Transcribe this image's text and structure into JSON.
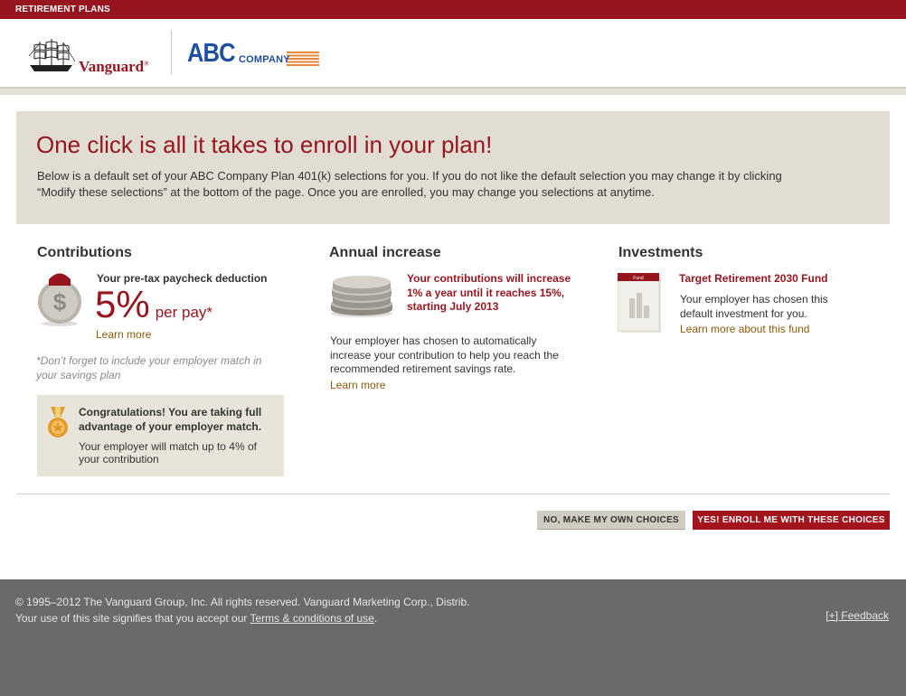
{
  "topbar": {
    "label": "RETIREMENT PLANS"
  },
  "header": {
    "vanguard_logo": {
      "word": "Vanguard",
      "mark": "®"
    },
    "employer_logo": {
      "word": "ABC",
      "sub": "COMPANY"
    }
  },
  "hero": {
    "title": "One click is all it takes to enroll in your plan!",
    "text": "Below is a default set of your ABC Company Plan 401(k) selections for you. If you do not like the default selection you may change it by clicking “Modify these selections” at the bottom of the page. Once you are enrolled, you may change you selections at anytime."
  },
  "contributions": {
    "title": "Contributions",
    "icon": "dollar-coin-icon",
    "label": "Your pre-tax paycheck deduction",
    "value": "5%",
    "unit": "per pay*",
    "learn_more": "Learn more",
    "note": "*Don’t forget to include your employer match in your savings plan",
    "congrats": {
      "icon": "medal-icon",
      "title": "Congratulations! You are taking full advantage of your employer match.",
      "text": "Your employer will match up to 4% of your contribution"
    }
  },
  "annual_increase": {
    "title": "Annual increase",
    "icon": "coin-stack-icon",
    "headline": "Your contributions will increase 1% a year until it reaches 15%, starting July 2013",
    "text": "Your employer has chosen to automatically increase your contribution to help you reach the recommended retirement savings rate.",
    "learn_more": "Learn more"
  },
  "investments": {
    "title": "Investments",
    "icon": "fund-document-icon",
    "icon_label": "Fund",
    "fund_name": "Target Retirement 2030 Fund",
    "text": "Your employer has chosen this default investment for you.",
    "learn_more": "Learn more about this fund"
  },
  "actions": {
    "decline": "NO, MAKE MY OWN CHOICES",
    "accept": "YES! ENROLL ME WITH THESE CHOICES"
  },
  "footer": {
    "copyright": "© 1995–2012  The Vanguard Group, Inc. All rights reserved. Vanguard Marketing Corp., Distrib.",
    "terms_prefix": "Your use of this site signifies that you accept our ",
    "terms_link": "Terms & conditions of use",
    "terms_suffix": ".",
    "feedback": "[+] Feedback"
  },
  "colors": {
    "brand_red": "#96151f",
    "accent_gold": "#8a5a0a",
    "panel_beige": "#e1ddd3",
    "footer_gray": "#6a6a6a"
  }
}
